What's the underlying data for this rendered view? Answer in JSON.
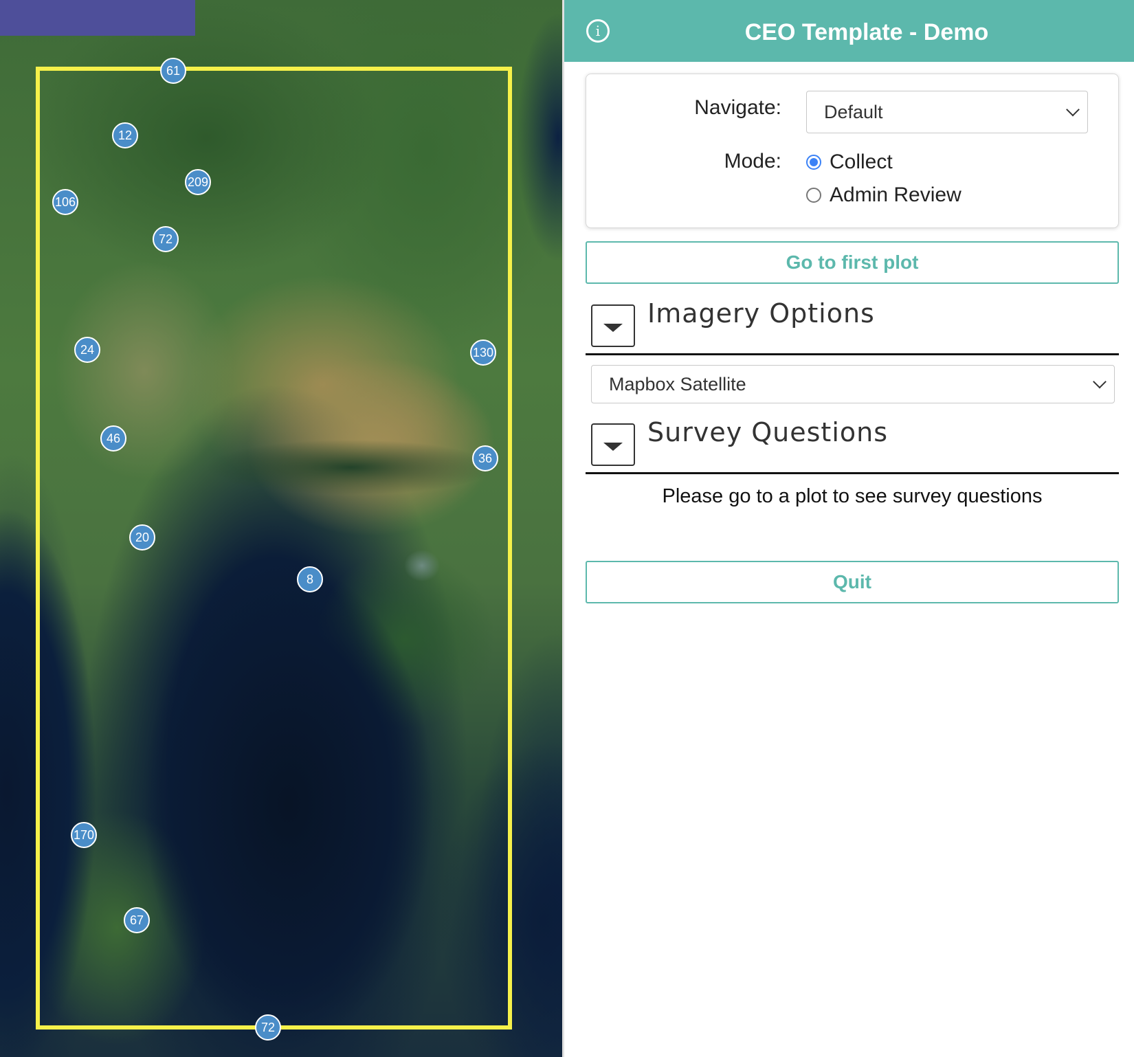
{
  "map": {
    "clusters": [
      {
        "label": "61"
      },
      {
        "label": "12"
      },
      {
        "label": "209"
      },
      {
        "label": "106"
      },
      {
        "label": "72"
      },
      {
        "label": "24"
      },
      {
        "label": "130"
      },
      {
        "label": "46"
      },
      {
        "label": "36"
      },
      {
        "label": "20"
      },
      {
        "label": "8"
      },
      {
        "label": "170"
      },
      {
        "label": "67"
      },
      {
        "label": "72"
      }
    ],
    "colors": {
      "boundary": "#f6f14a",
      "cluster": "#4a8dc8",
      "tab": "#4e4f9a"
    }
  },
  "header": {
    "title": "CEO Template - Demo",
    "info_icon": "info-circle-icon",
    "color": "#5cb8ac"
  },
  "navigate": {
    "label": "Navigate:",
    "selected": "Default"
  },
  "mode": {
    "label": "Mode:",
    "options": [
      {
        "label": "Collect",
        "checked": true
      },
      {
        "label": "Admin Review",
        "checked": false
      }
    ]
  },
  "buttons": {
    "first_plot": "Go to first plot",
    "quit": "Quit"
  },
  "imagery": {
    "title": "Imagery Options",
    "selected": "Mapbox Satellite"
  },
  "survey": {
    "title": "Survey Questions",
    "message": "Please go to a plot to see survey questions"
  }
}
